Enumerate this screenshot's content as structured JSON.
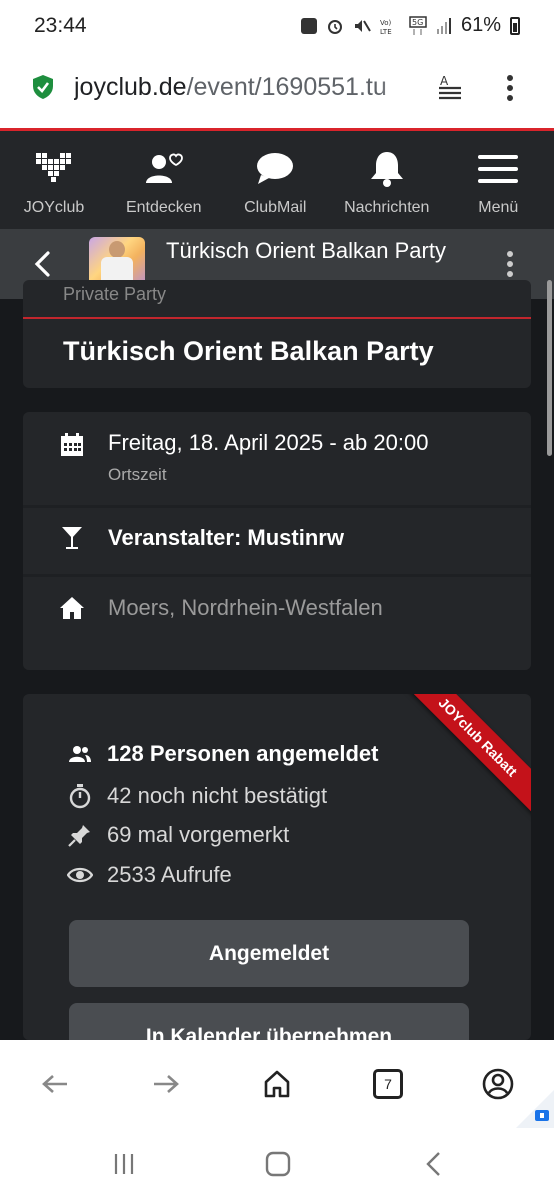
{
  "status_bar": {
    "time": "23:44",
    "battery": "61%",
    "icons": [
      "upload-icon",
      "alarm-icon",
      "mute-icon",
      "volte-icon",
      "5g-icon",
      "signal-icon",
      "battery-icon"
    ]
  },
  "browser": {
    "url_domain": "joyclub.de",
    "url_path": "/event/1690551.tu",
    "tab_count": "7"
  },
  "nav": {
    "items": [
      {
        "label": "JOYclub",
        "icon": "heart-pixel-icon"
      },
      {
        "label": "Entdecken",
        "icon": "discover-icon"
      },
      {
        "label": "ClubMail",
        "icon": "chat-icon"
      },
      {
        "label": "Nachrichten",
        "icon": "bell-icon"
      },
      {
        "label": "Menü",
        "icon": "menu-icon"
      }
    ]
  },
  "event_header": {
    "title": "Türkisch Orient Balkan Party"
  },
  "event": {
    "type_label": "Private Party",
    "title": "Türkisch Orient Balkan Party",
    "date": "Freitag, 18. April 2025 - ab 20:00",
    "date_sub": "Ortszeit",
    "organizer": "Veranstalter: Mustinrw",
    "location": "Moers, Nordrhein-Westfalen"
  },
  "stats": {
    "ribbon": "JOYclub Rabatt",
    "registered": "128 Personen angemeldet",
    "unconfirmed": "42 noch nicht bestätigt",
    "bookmarked": "69 mal vorgemerkt",
    "views": "2533 Aufrufe"
  },
  "buttons": {
    "registered": "Angemeldet",
    "calendar": "In Kalender übernehmen"
  },
  "colors": {
    "accent": "#d9242b",
    "background": "#17191c",
    "card": "#242629",
    "button": "#4a4d51"
  }
}
